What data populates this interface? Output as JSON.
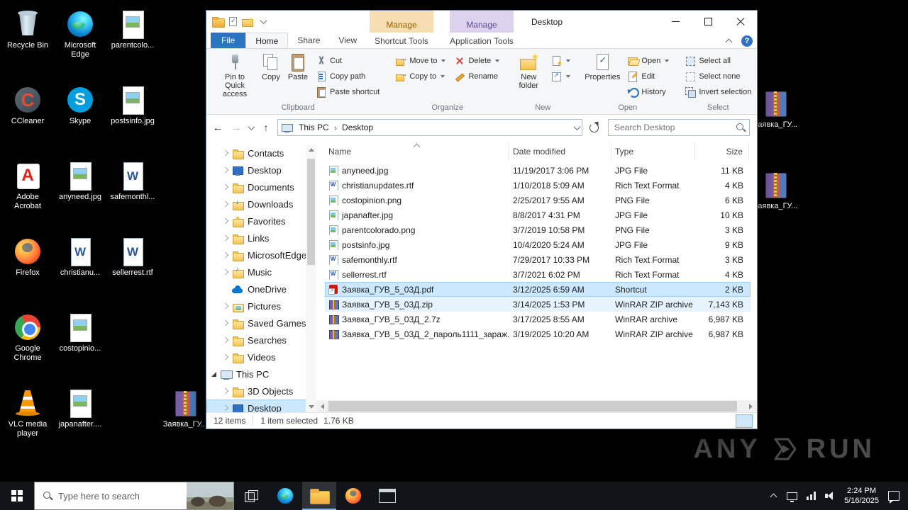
{
  "colors": {
    "accent": "#0078d7",
    "file_tab": "#2b74bf",
    "selection": "#cce8ff",
    "selection_border": "#99d1ff",
    "hover_row": "#e5f3ff",
    "manage1_bg": "#f7ddb2",
    "manage1_text": "#9a6200",
    "manage2_bg": "#dcd2ee",
    "manage2_text": "#5e4b9a",
    "taskbar_bg": "#11151a",
    "taskbar_underline": "#76b9ed"
  },
  "window": {
    "title": "Desktop",
    "contextual": [
      {
        "header": "Manage",
        "tab": "Shortcut Tools"
      },
      {
        "header": "Manage",
        "tab": "Application Tools"
      }
    ],
    "tabs": {
      "file": "File",
      "home": "Home",
      "share": "Share",
      "view": "View"
    }
  },
  "ribbon": {
    "pin_to_quick_access": "Pin to Quick access",
    "copy": "Copy",
    "paste": "Paste",
    "cut": "Cut",
    "copy_path": "Copy path",
    "paste_shortcut": "Paste shortcut",
    "move_to": "Move to",
    "copy_to": "Copy to",
    "delete": "Delete",
    "rename": "Rename",
    "new_folder": "New folder",
    "properties": "Properties",
    "open": "Open",
    "edit": "Edit",
    "history": "History",
    "select_all": "Select all",
    "select_none": "Select none",
    "invert_selection": "Invert selection",
    "group_labels": {
      "clipboard": "Clipboard",
      "organize": "Organize",
      "new": "New",
      "open": "Open",
      "select": "Select"
    }
  },
  "address_bar": {
    "crumb_root": "This PC",
    "crumb_current": "Desktop",
    "search_placeholder": "Search Desktop"
  },
  "navigation": [
    {
      "label": "Contacts",
      "icon": "ni-folder",
      "icon_name": "contacts-folder-icon",
      "lvl": "lvl1",
      "chev": "collapsed"
    },
    {
      "label": "Desktop",
      "icon": "ni-desktop",
      "icon_name": "desktop-folder-icon",
      "lvl": "lvl1",
      "chev": "collapsed"
    },
    {
      "label": "Documents",
      "icon": "ni-folder",
      "icon_name": "documents-folder-icon",
      "lvl": "lvl1",
      "chev": "collapsed"
    },
    {
      "label": "Downloads",
      "icon": "ni-down",
      "icon_name": "downloads-folder-icon",
      "lvl": "lvl1",
      "chev": "collapsed"
    },
    {
      "label": "Favorites",
      "icon": "ni-fav",
      "icon_name": "favorites-folder-icon",
      "lvl": "lvl1",
      "chev": "collapsed"
    },
    {
      "label": "Links",
      "icon": "ni-folder",
      "icon_name": "links-folder-icon",
      "lvl": "lvl1",
      "chev": "collapsed"
    },
    {
      "label": "MicrosoftEdge...",
      "icon": "ni-folder",
      "icon_name": "folder-icon",
      "lvl": "lvl1",
      "chev": "collapsed"
    },
    {
      "label": "Music",
      "icon": "ni-music",
      "icon_name": "music-folder-icon",
      "lvl": "lvl1",
      "chev": "collapsed"
    },
    {
      "label": "OneDrive",
      "icon": "ni-cloud",
      "icon_name": "onedrive-icon",
      "lvl": "lvl1",
      "chev": "none"
    },
    {
      "label": "Pictures",
      "icon": "ni-pic",
      "icon_name": "pictures-folder-icon",
      "lvl": "lvl1",
      "chev": "collapsed"
    },
    {
      "label": "Saved Games",
      "icon": "ni-folder",
      "icon_name": "saved-games-folder-icon",
      "lvl": "lvl1",
      "chev": "collapsed"
    },
    {
      "label": "Searches",
      "icon": "ni-folder",
      "icon_name": "searches-folder-icon",
      "lvl": "lvl1",
      "chev": "collapsed"
    },
    {
      "label": "Videos",
      "icon": "ni-folder",
      "icon_name": "videos-folder-icon",
      "lvl": "lvl1",
      "chev": "collapsed"
    },
    {
      "label": "This PC",
      "icon": "ni-pc",
      "icon_name": "this-pc-icon",
      "lvl": "lvl0",
      "chev": "expanded"
    },
    {
      "label": "3D Objects",
      "icon": "ni-folder",
      "icon_name": "3d-objects-folder-icon",
      "lvl": "lvl1",
      "chev": "collapsed"
    },
    {
      "label": "Desktop",
      "icon": "ni-desktop",
      "icon_name": "desktop-folder-icon",
      "lvl": "lvl1",
      "chev": "collapsed",
      "state": "selected"
    }
  ],
  "files": {
    "columns": {
      "name": "Name",
      "date": "Date modified",
      "type": "Type",
      "size": "Size"
    },
    "rows": [
      {
        "name": "anyneed.jpg",
        "icon": "fi-img",
        "icon_name": "jpg-file-icon",
        "date": "11/19/2017 3:06 PM",
        "type": "JPG File",
        "size": "11 KB"
      },
      {
        "name": "christianupdates.rtf",
        "icon": "fi-rtf",
        "icon_name": "rtf-file-icon",
        "date": "1/10/2018 5:09 AM",
        "type": "Rich Text Format",
        "size": "4 KB"
      },
      {
        "name": "costopinion.png",
        "icon": "fi-img",
        "icon_name": "png-file-icon",
        "date": "2/25/2017 9:55 AM",
        "type": "PNG File",
        "size": "6 KB"
      },
      {
        "name": "japanafter.jpg",
        "icon": "fi-img",
        "icon_name": "jpg-file-icon",
        "date": "8/8/2017 4:31 PM",
        "type": "JPG File",
        "size": "10 KB"
      },
      {
        "name": "parentcolorado.png",
        "icon": "fi-img",
        "icon_name": "png-file-icon",
        "date": "3/7/2019 10:58 PM",
        "type": "PNG File",
        "size": "3 KB"
      },
      {
        "name": "postsinfo.jpg",
        "icon": "fi-img",
        "icon_name": "jpg-file-icon",
        "date": "10/4/2020 5:24 AM",
        "type": "JPG File",
        "size": "9 KB"
      },
      {
        "name": "safemonthly.rtf",
        "icon": "fi-rtf",
        "icon_name": "rtf-file-icon",
        "date": "7/29/2017 10:33 PM",
        "type": "Rich Text Format",
        "size": "3 KB"
      },
      {
        "name": "sellerrest.rtf",
        "icon": "fi-rtf",
        "icon_name": "rtf-file-icon",
        "date": "3/7/2021 6:02 PM",
        "type": "Rich Text Format",
        "size": "4 KB"
      },
      {
        "name": "Заявка_ГУВ_5_03Д.pdf",
        "icon": "fi-pdf",
        "icon_name": "pdf-shortcut-icon",
        "date": "3/12/2025 6:59 AM",
        "type": "Shortcut",
        "size": "2 KB",
        "state": "selected"
      },
      {
        "name": "Заявка_ГУВ_5_03Д.zip",
        "icon": "fi-rar",
        "icon_name": "winrar-zip-icon",
        "date": "3/14/2025 1:53 PM",
        "type": "WinRAR ZIP archive",
        "size": "7,143 KB",
        "state": "hover"
      },
      {
        "name": "Заявка_ГУВ_5_03Д_2.7z",
        "icon": "fi-rar",
        "icon_name": "winrar-archive-icon",
        "date": "3/17/2025 8:55 AM",
        "type": "WinRAR archive",
        "size": "6,987 KB"
      },
      {
        "name": "Заявка_ГУВ_5_03Д_2_пароль1111_зараж...",
        "icon": "fi-rar",
        "icon_name": "winrar-zip-icon",
        "date": "3/19/2025 10:20 AM",
        "type": "WinRAR ZIP archive",
        "size": "6,987 KB"
      }
    ]
  },
  "status_bar": {
    "count": "12 items",
    "selection": "1 item selected",
    "size": "1.76 KB"
  },
  "desktop_icons": {
    "left": [
      {
        "label": "Recycle Bin",
        "icon": "di-recycle",
        "icon_name": "recycle-bin-icon"
      },
      {
        "label": "CCleaner",
        "icon": "di-ccleaner",
        "icon_name": "ccleaner-icon"
      },
      {
        "label": "Adobe Acrobat",
        "icon": "di-acrobat",
        "icon_name": "adobe-acrobat-icon"
      },
      {
        "label": "Firefox",
        "icon": "di-firefox",
        "icon_name": "firefox-icon"
      },
      {
        "label": "Google Chrome",
        "icon": "di-chrome",
        "icon_name": "google-chrome-icon"
      },
      {
        "label": "VLC media player",
        "icon": "di-vlc",
        "icon_name": "vlc-icon"
      },
      {
        "label": "Microsoft Edge",
        "icon": "di-edge",
        "icon_name": "microsoft-edge-icon"
      },
      {
        "label": "Skype",
        "icon": "di-skype",
        "icon_name": "skype-icon"
      },
      {
        "label": "anyneed.jpg",
        "icon": "di-image",
        "icon_name": "image-file-icon"
      },
      {
        "label": "christianu...",
        "icon": "di-doc",
        "icon_name": "word-document-icon"
      },
      {
        "label": "costopinio...",
        "icon": "di-image",
        "icon_name": "image-file-icon"
      },
      {
        "label": "japanafter....",
        "icon": "di-image",
        "icon_name": "image-file-icon"
      },
      {
        "label": "parentcolo...",
        "icon": "di-image",
        "icon_name": "image-file-icon"
      },
      {
        "label": "postsinfo.jpg",
        "icon": "di-image",
        "icon_name": "image-file-icon"
      },
      {
        "label": "safemonthl...",
        "icon": "di-doc",
        "icon_name": "word-document-icon"
      },
      {
        "label": "sellerrest.rtf",
        "icon": "di-doc",
        "icon_name": "word-document-icon"
      },
      {
        "label": "Заявка_ГУ...",
        "icon": "di-rar",
        "icon_name": "winrar-archive-icon",
        "slot": "slot-c4r6"
      }
    ],
    "right": [
      {
        "label": "Заявка_ГУ...",
        "icon": "di-rar",
        "icon_name": "winrar-archive-icon"
      },
      {
        "label": "Заявка_ГУ...",
        "icon": "di-rar",
        "icon_name": "winrar-archive-icon"
      }
    ]
  },
  "taskbar": {
    "search_placeholder": "Type here to search",
    "time": "2:24 PM",
    "date": "5/16/2025"
  },
  "watermark": {
    "brand_left": "ANY",
    "brand_right": "RUN"
  }
}
